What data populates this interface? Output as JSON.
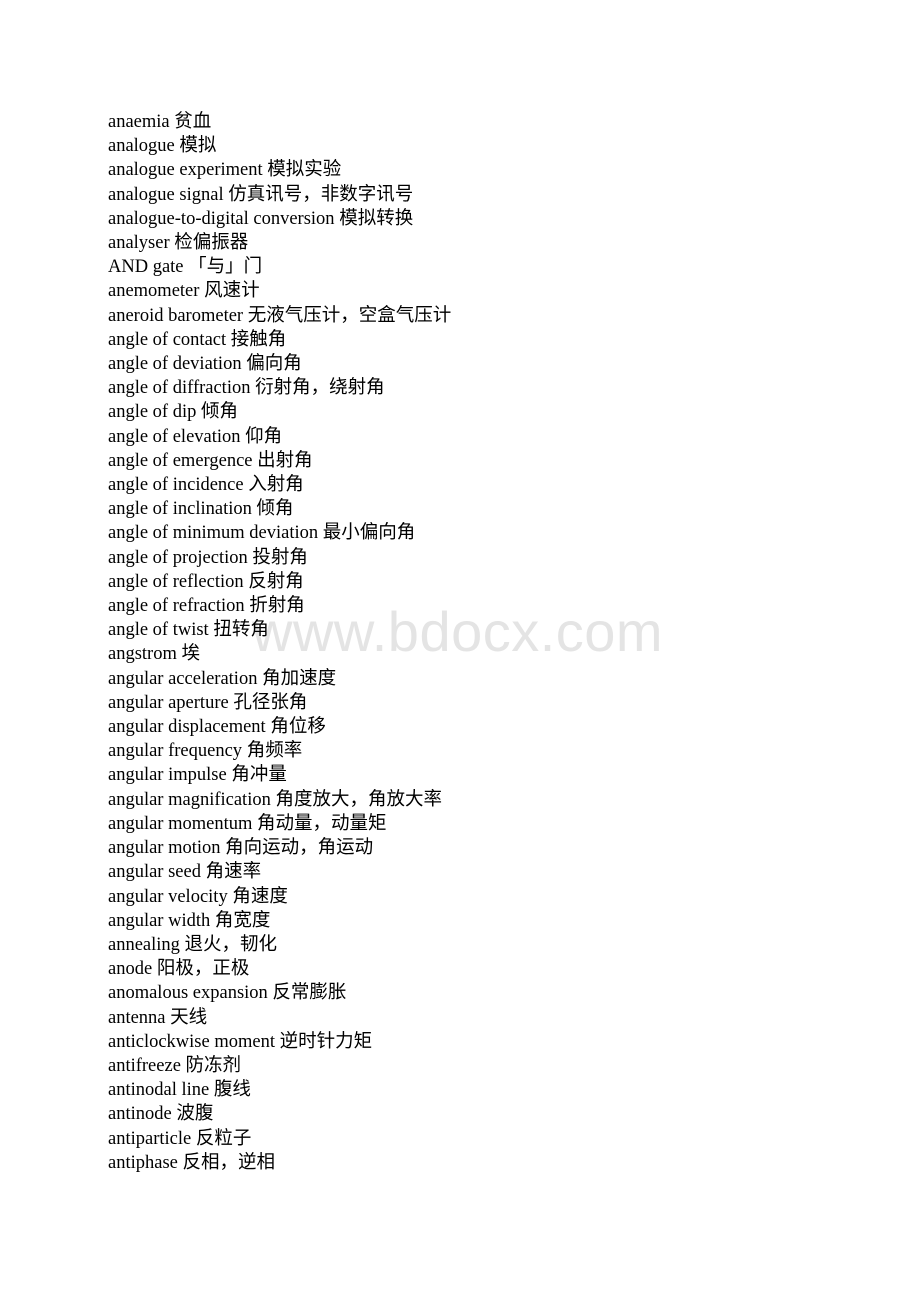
{
  "page": {
    "background_color": "#ffffff",
    "text_color": "#000000"
  },
  "watermark": {
    "text": "www.bdocx.com",
    "color": "#e4e4e4"
  },
  "glossary": {
    "entries": [
      {
        "term": "anaemia",
        "gloss": "贫血"
      },
      {
        "term": "analogue",
        "gloss": "模拟"
      },
      {
        "term": "analogue experiment",
        "gloss": "模拟实验"
      },
      {
        "term": "analogue signal",
        "gloss": "仿真讯号，非数字讯号"
      },
      {
        "term": "analogue-to-digital conversion",
        "gloss": "模拟转换"
      },
      {
        "term": "analyser",
        "gloss": "检偏振器"
      },
      {
        "term": "AND gate",
        "gloss": "「与」门"
      },
      {
        "term": "anemometer",
        "gloss": "风速计"
      },
      {
        "term": "aneroid barometer",
        "gloss": "无液气压计，空盒气压计"
      },
      {
        "term": "angle of contact",
        "gloss": "接触角"
      },
      {
        "term": "angle of deviation",
        "gloss": "偏向角"
      },
      {
        "term": "angle of diffraction",
        "gloss": "衍射角，绕射角"
      },
      {
        "term": "angle of dip",
        "gloss": "倾角"
      },
      {
        "term": "angle of elevation",
        "gloss": "仰角"
      },
      {
        "term": "angle of emergence",
        "gloss": "出射角"
      },
      {
        "term": "angle of incidence",
        "gloss": "入射角"
      },
      {
        "term": "angle of inclination",
        "gloss": "倾角"
      },
      {
        "term": "angle of minimum deviation",
        "gloss": "最小偏向角"
      },
      {
        "term": "angle of projection",
        "gloss": "投射角"
      },
      {
        "term": "angle of reflection",
        "gloss": "反射角"
      },
      {
        "term": "angle of refraction",
        "gloss": "折射角"
      },
      {
        "term": "angle of twist",
        "gloss": "扭转角"
      },
      {
        "term": "angstrom",
        "gloss": "埃"
      },
      {
        "term": "angular acceleration",
        "gloss": "角加速度"
      },
      {
        "term": "angular aperture",
        "gloss": "孔径张角"
      },
      {
        "term": "angular displacement",
        "gloss": "角位移"
      },
      {
        "term": "angular frequency",
        "gloss": "角频率"
      },
      {
        "term": "angular impulse",
        "gloss": "角冲量"
      },
      {
        "term": "angular magnification",
        "gloss": "角度放大，角放大率"
      },
      {
        "term": "angular momentum",
        "gloss": "角动量，动量矩"
      },
      {
        "term": "angular motion",
        "gloss": "角向运动，角运动"
      },
      {
        "term": "angular seed",
        "gloss": "角速率"
      },
      {
        "term": "angular velocity",
        "gloss": "角速度"
      },
      {
        "term": "angular width",
        "gloss": "角宽度"
      },
      {
        "term": "annealing",
        "gloss": "退火，韧化"
      },
      {
        "term": "anode",
        "gloss": "阳极，正极"
      },
      {
        "term": "anomalous expansion",
        "gloss": "反常膨胀"
      },
      {
        "term": "antenna",
        "gloss": "天线"
      },
      {
        "term": "anticlockwise moment",
        "gloss": "逆时针力矩"
      },
      {
        "term": "antifreeze",
        "gloss": "防冻剂"
      },
      {
        "term": "antinodal line",
        "gloss": "腹线"
      },
      {
        "term": "antinode",
        "gloss": "波腹"
      },
      {
        "term": "antiparticle",
        "gloss": "反粒子"
      },
      {
        "term": "antiphase",
        "gloss": "反相，逆相"
      }
    ]
  }
}
